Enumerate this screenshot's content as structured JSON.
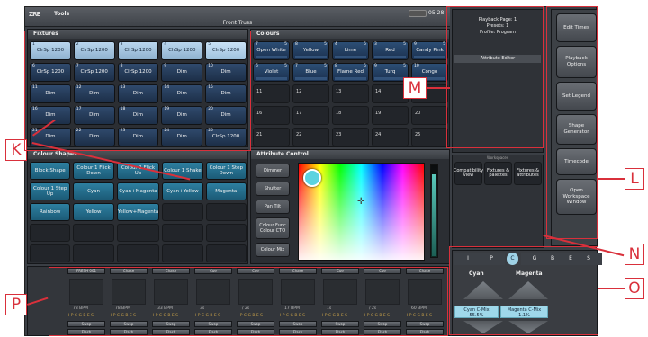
{
  "app": {
    "tools_label": "Tools",
    "window_title": "Front Truss",
    "clock": "05:28",
    "logo": "ZRE"
  },
  "fixtures": {
    "title": "Fixtures",
    "items": [
      {
        "num": "1",
        "label": "ClrSp 1200",
        "style": "light"
      },
      {
        "num": "2",
        "label": "ClrSp 1200",
        "style": "light"
      },
      {
        "num": "3",
        "label": "ClrSp 1200",
        "style": "light"
      },
      {
        "num": "4",
        "label": "ClrSp 1200",
        "style": "light"
      },
      {
        "num": "5",
        "label": "ClrSp 1200",
        "style": "sel"
      },
      {
        "num": "6",
        "label": "ClrSp 1200",
        "style": "dark"
      },
      {
        "num": "7",
        "label": "ClrSp 1200",
        "style": "dark"
      },
      {
        "num": "8",
        "label": "ClrSp 1200",
        "style": "dark"
      },
      {
        "num": "9",
        "label": "Dim",
        "style": "dark"
      },
      {
        "num": "10",
        "label": "Dim",
        "style": "dark"
      },
      {
        "num": "11",
        "label": "Dim",
        "style": "dark"
      },
      {
        "num": "12",
        "label": "Dim",
        "style": "dark"
      },
      {
        "num": "13",
        "label": "Dim",
        "style": "dark"
      },
      {
        "num": "14",
        "label": "Dim",
        "style": "dark"
      },
      {
        "num": "15",
        "label": "Dim",
        "style": "dark"
      },
      {
        "num": "16",
        "label": "Dim",
        "style": "dark"
      },
      {
        "num": "17",
        "label": "Dim",
        "style": "dark"
      },
      {
        "num": "18",
        "label": "Dim",
        "style": "dark"
      },
      {
        "num": "19",
        "label": "Dim",
        "style": "dark"
      },
      {
        "num": "20",
        "label": "Dim",
        "style": "dark"
      },
      {
        "num": "21",
        "label": "Dim",
        "style": "dark"
      },
      {
        "num": "22",
        "label": "Dim",
        "style": "dark"
      },
      {
        "num": "23",
        "label": "Dim",
        "style": "dark"
      },
      {
        "num": "24",
        "label": "Dim",
        "style": "dark"
      },
      {
        "num": "25",
        "label": "ClrSp 1200",
        "style": "dark"
      }
    ]
  },
  "colours": {
    "title": "Colours",
    "items": [
      {
        "num": "7",
        "label": "Open White",
        "cnt": "5"
      },
      {
        "num": "8",
        "label": "Yellow",
        "cnt": "5"
      },
      {
        "num": "4",
        "label": "Lime",
        "cnt": "5"
      },
      {
        "num": "3",
        "label": "Red",
        "cnt": "5"
      },
      {
        "num": "9",
        "label": "Candy Pink",
        "cnt": "5"
      },
      {
        "num": "6",
        "label": "Violet",
        "cnt": "5"
      },
      {
        "num": "7",
        "label": "Blue",
        "cnt": "5"
      },
      {
        "num": "8",
        "label": "Flame Red",
        "cnt": "5"
      },
      {
        "num": "9",
        "label": "Turq",
        "cnt": "5"
      },
      {
        "num": "10",
        "label": "Congo",
        "cnt": ""
      }
    ],
    "empty": [
      "11",
      "12",
      "13",
      "14",
      "15",
      "16",
      "17",
      "18",
      "19",
      "20",
      "21",
      "22",
      "23",
      "24",
      "25"
    ]
  },
  "shapes": {
    "title": "Colour Shapes",
    "items": [
      "Block Shape",
      "Colour 1 Flick Down",
      "Colour 1 Flick Up",
      "Colour 1 Shake",
      "Colour 1 Step Down",
      "Colour 1 Step Up",
      "Cyan",
      "Cyan+Magenta",
      "Cyan+Yellow",
      "Magenta",
      "Rainbow",
      "Yellow",
      "Yellow+Magenta"
    ]
  },
  "attr": {
    "title": "Attribute Control",
    "buttons": [
      "Dimmer",
      "Shutter",
      "Pan Tilt",
      "Colour Func Colour CTO",
      "Colour Mix"
    ]
  },
  "playback": {
    "line1": "Playback Page: 1",
    "line2": "Presets: 1",
    "line3": "Profile: Program",
    "editor": "Attribute Editor"
  },
  "workspaces": {
    "title": "Workspaces",
    "items": [
      "Compatibility view",
      "Fixtures & palettes",
      "Fixtures & attributes"
    ]
  },
  "right_buttons": [
    "Edit Times",
    "Playback Options",
    "Set Legend",
    "Shape Generator",
    "Timecode",
    "Open Workspace Window"
  ],
  "wheels": {
    "tabs": [
      "I",
      "P",
      "C",
      "G",
      "B",
      "E",
      "S"
    ],
    "names": [
      "Cyan",
      "Magenta"
    ],
    "mixes": [
      {
        "label": "Cyan C-Mix",
        "value": "55.5%"
      },
      {
        "label": "Magenta C-Mix",
        "value": "1.1%"
      }
    ]
  },
  "faders": {
    "head": [
      "FRESH 001",
      "Chase",
      "Chase",
      "Cue",
      "Cue",
      "Chase",
      "Cue",
      "Cue",
      "Chase"
    ],
    "times": [
      "78 BPM",
      "78 BPM",
      "33 BPM",
      "3s",
      "/ 2s",
      "17 BPM",
      "1s",
      "/ 2s",
      "60 BPM"
    ],
    "codes": "I P C G B E S",
    "swap": "Swop",
    "flash": "Flash"
  },
  "callouts": {
    "K": "K",
    "L": "L",
    "M": "M",
    "N": "N",
    "O": "O",
    "P": "P"
  }
}
